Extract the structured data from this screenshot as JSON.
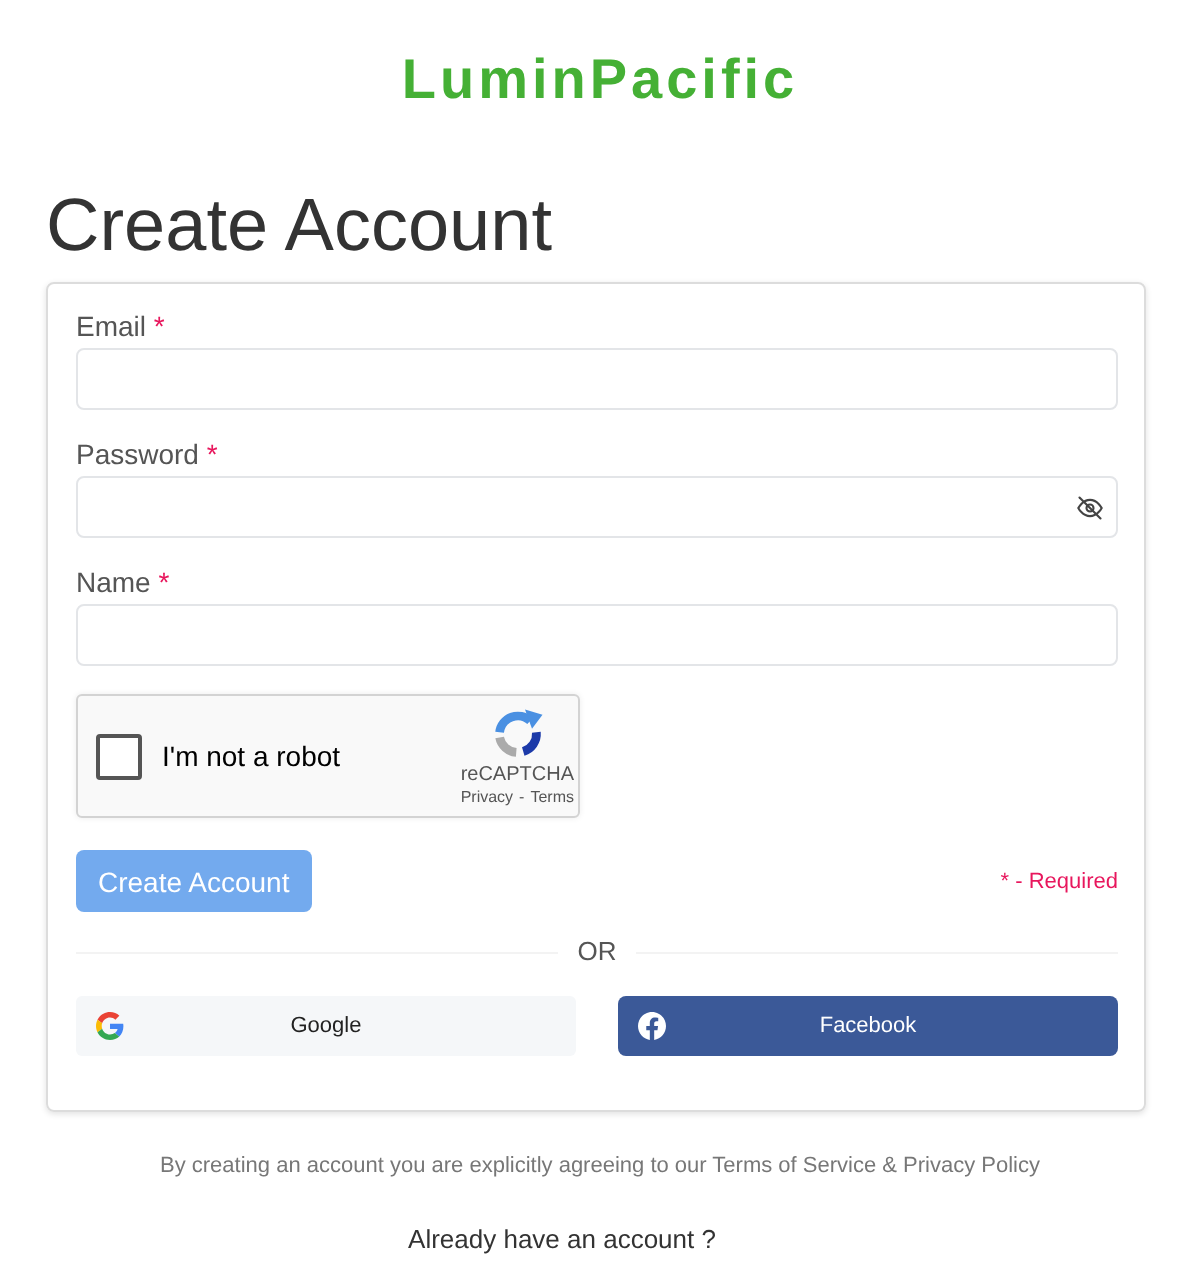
{
  "logo": {
    "text": "LuminPacific"
  },
  "title": "Create Account",
  "form": {
    "fields": [
      {
        "label": "Email",
        "required_mark": "*",
        "kind": "text"
      },
      {
        "label": "Password",
        "required_mark": "*",
        "kind": "password"
      },
      {
        "label": "Name",
        "required_mark": "*",
        "kind": "text"
      }
    ],
    "captcha": {
      "label": "I'm not a robot",
      "checked": false,
      "brand": "reCAPTCHA",
      "privacy_link": "Privacy",
      "separator": "-",
      "terms_link": "Terms"
    },
    "submit": {
      "label": "Create Account",
      "disabled": true
    },
    "required_note": "* - Required",
    "divider": "OR",
    "social_buttons": [
      {
        "label": "Google",
        "kind": "google"
      },
      {
        "label": "Facebook",
        "kind": "facebook"
      }
    ]
  },
  "terms_notice": "By creating an account you are explicitly agreeing to our Terms of Service & Privacy Policy",
  "signin_prompt": "Already have an account ?"
}
